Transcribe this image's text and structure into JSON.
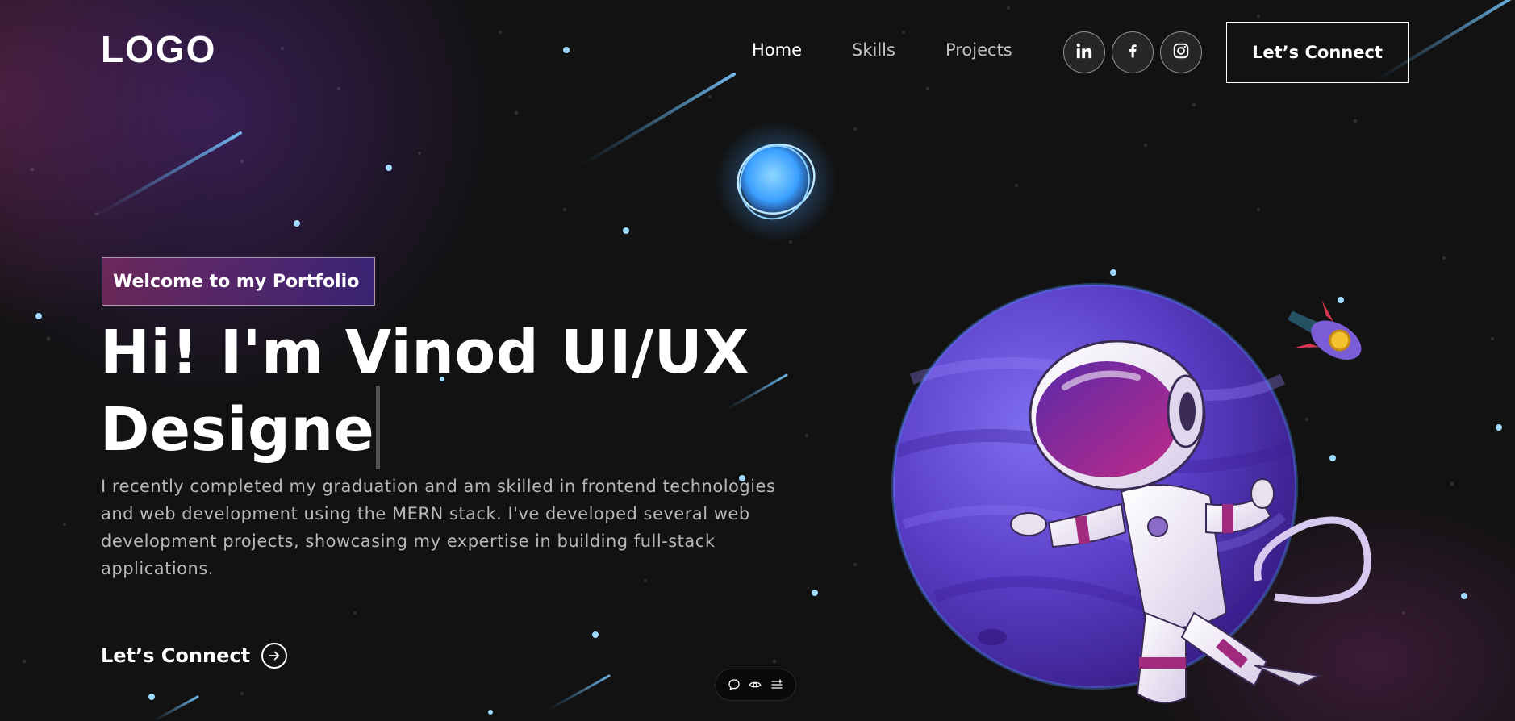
{
  "navbar": {
    "logo_text": "LOGO",
    "links": [
      {
        "label": "Home"
      },
      {
        "label": "Skills"
      },
      {
        "label": "Projects"
      }
    ],
    "social": [
      {
        "icon": "linkedin-icon"
      },
      {
        "icon": "facebook-icon"
      },
      {
        "icon": "instagram-icon"
      }
    ],
    "connect_label": "Let’s Connect"
  },
  "hero": {
    "tagline": "Welcome to my Portfolio",
    "headline_line1": "Hi! I'm Vinod UI/UX",
    "headline_line2": "Designe",
    "description": "I recently completed my graduation and am skilled in frontend technologies and web development using the MERN stack. I've developed several web development projects, showcasing my expertise in building full-stack applications.",
    "cta_label": "Let’s Connect",
    "cta_icon": "arrow-right-circle-icon"
  },
  "toolbar": {
    "icons": [
      "comment-icon",
      "eye-icon",
      "menu-list-icon"
    ]
  },
  "colors": {
    "background": "#121212",
    "tagline_gradient_start": "#aa367c",
    "tagline_gradient_end": "#4a2fbd",
    "planet_purple": "#6a4fd8",
    "star_blue": "#8fd3ff"
  }
}
